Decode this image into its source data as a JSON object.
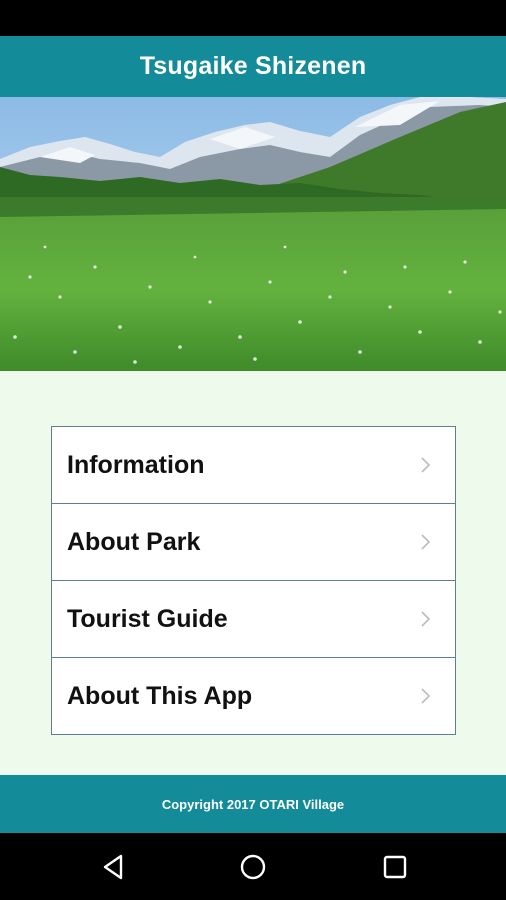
{
  "app": {
    "title": "Tsugaike Shizenen"
  },
  "menu": {
    "items": [
      {
        "label": "Information"
      },
      {
        "label": "About Park"
      },
      {
        "label": "Tourist Guide"
      },
      {
        "label": "About This App"
      }
    ]
  },
  "footer": {
    "copyright": "Copyright 2017 OTARI Village"
  },
  "icons": {
    "chevron": "chevron-right-icon",
    "back": "back-triangle-icon",
    "home": "home-circle-icon",
    "recents": "recents-square-icon"
  },
  "colors": {
    "accent": "#138b98",
    "content_background": "#eefaec",
    "menu_border": "#5f7f8f"
  }
}
